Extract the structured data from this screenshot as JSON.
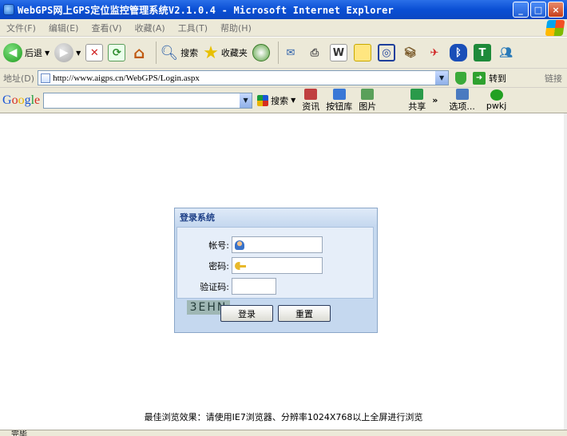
{
  "window": {
    "title": "WebGPS网上GPS定位监控管理系统V2.1.0.4 - Microsoft Internet Explorer",
    "controls": {
      "minimize": "_",
      "maximize": "□",
      "close": "×"
    }
  },
  "menu": {
    "items": [
      "文件(F)",
      "编辑(E)",
      "查看(V)",
      "收藏(A)",
      "工具(T)",
      "帮助(H)"
    ]
  },
  "toolbar": {
    "back_label": "后退",
    "search_label": "搜索",
    "favorites_label": "收藏夹"
  },
  "address": {
    "label": "地址(D)",
    "url": "http://www.aigps.cn/WebGPS/Login.aspx",
    "go_label": "转到",
    "links_label": "链接"
  },
  "googlebar": {
    "logo": [
      "G",
      "o",
      "o",
      "g",
      "l",
      "e"
    ],
    "search_label": "搜索",
    "items": [
      "资讯",
      "按钮库",
      "图片",
      "共享",
      "选项...",
      "pwkj"
    ]
  },
  "login": {
    "title": "登录系统",
    "account_label": "帐号:",
    "password_label": "密码:",
    "code_label": "验证码:",
    "captcha_text": "3EHN",
    "login_button": "登录",
    "reset_button": "重置"
  },
  "footer": {
    "note": "最佳浏览效果：请使用IE7浏览器、分辨率1024X768以上全屏进行浏览"
  },
  "status": {
    "text": "完毕"
  }
}
